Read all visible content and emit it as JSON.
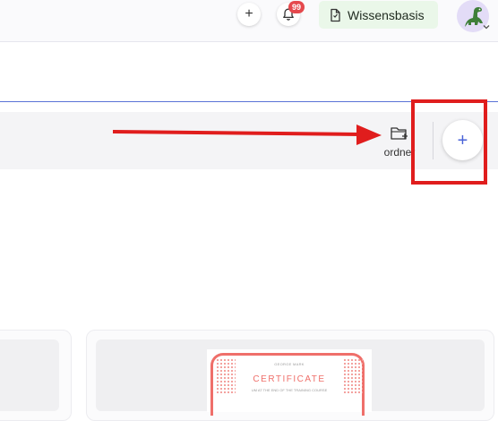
{
  "header": {
    "add_symbol": "+",
    "notification_count": "99",
    "knowledge_base_label": "Wissensbasis"
  },
  "toolbar": {
    "folder_label": "ordner",
    "add_symbol": "+"
  },
  "certificate": {
    "recipient": "GEORGE MARK",
    "title": "CERTIFICATE",
    "subtitle": "UM AT THE END OF THE TRAINING COURSE"
  },
  "colors": {
    "annotation_red": "#e01d1d",
    "accent_blue": "#5b73d6",
    "badge_red": "#e5484d",
    "knowledge_base_bg": "#eaf7e9",
    "certificate_red": "#ef6f6a"
  },
  "icons": {
    "header_add": "plus-icon",
    "notifications": "bell-icon",
    "knowledge_base": "document-icon",
    "avatar": "dinosaur-icon",
    "avatar_menu": "chevron-down-icon",
    "new_folder": "folder-plus-icon",
    "add": "plus-icon"
  }
}
